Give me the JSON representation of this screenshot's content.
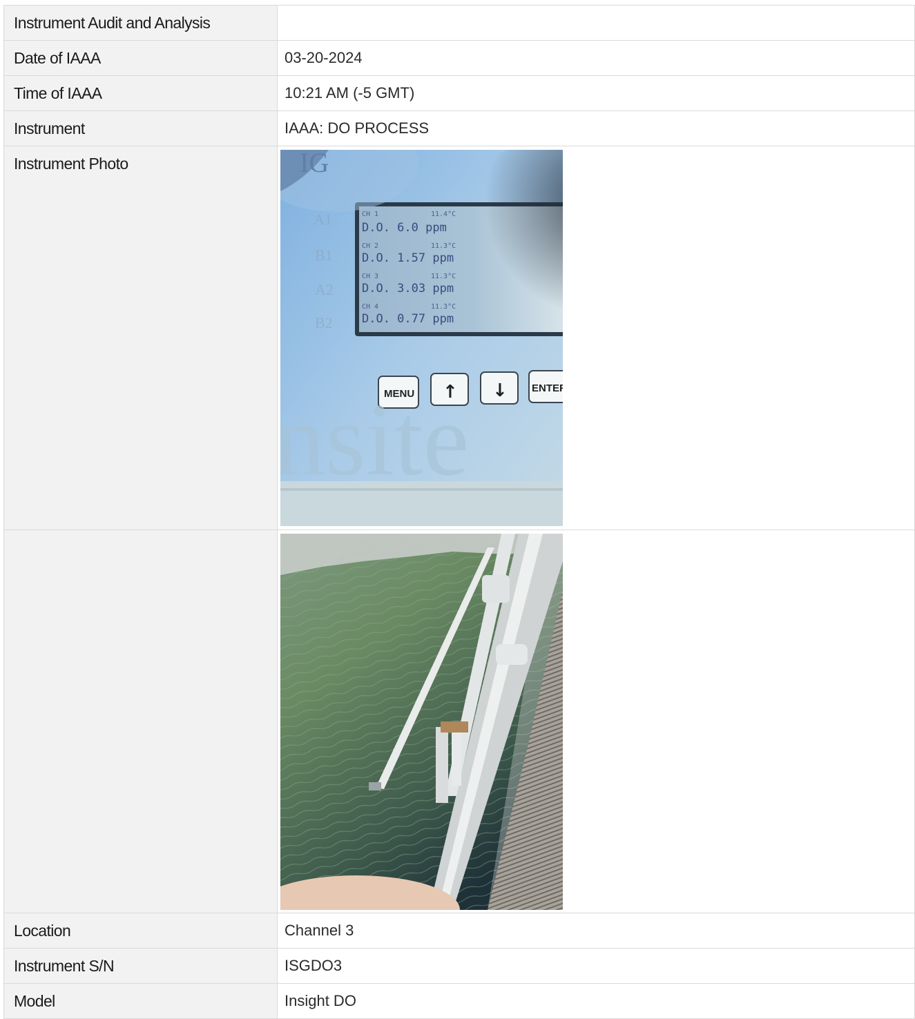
{
  "rows": [
    {
      "label": "Instrument Audit and Analysis",
      "value": ""
    },
    {
      "label": "Date of IAAA",
      "value": "03-20-2024"
    },
    {
      "label": "Time of IAAA",
      "value": "10:21 AM (-5 GMT)"
    },
    {
      "label": "Instrument",
      "value": "IAAA: DO PROCESS"
    }
  ],
  "photo_label": "Instrument Photo",
  "photo1": {
    "logo": "IG",
    "channel_labels": [
      "A1",
      "B1",
      "A2",
      "B2"
    ],
    "display": [
      {
        "ch": "CH 1",
        "temp": "11.4°C",
        "reading": "D.O.  6.0 ppm"
      },
      {
        "ch": "CH 2",
        "temp": "11.3°C",
        "reading": "D.O. 1.57 ppm"
      },
      {
        "ch": "CH 3",
        "temp": "11.3°C",
        "reading": "D.O. 3.03 ppm"
      },
      {
        "ch": "CH 4",
        "temp": "11.3°C",
        "reading": "D.O. 0.77 ppm"
      }
    ],
    "buttons": [
      "MENU",
      "↑",
      "↓",
      "ENTER"
    ],
    "brand": "nsite"
  },
  "rows_after": [
    {
      "label": "Location",
      "value": "Channel 3"
    },
    {
      "label": "Instrument S/N",
      "value": "ISGDO3"
    },
    {
      "label": "Model",
      "value": "Insight DO"
    }
  ],
  "colors": {
    "label_bg": "#f2f2f2",
    "border": "#d9d9d9",
    "panel_blue": "#9ec3e6",
    "water_green": "#5a7a55"
  }
}
